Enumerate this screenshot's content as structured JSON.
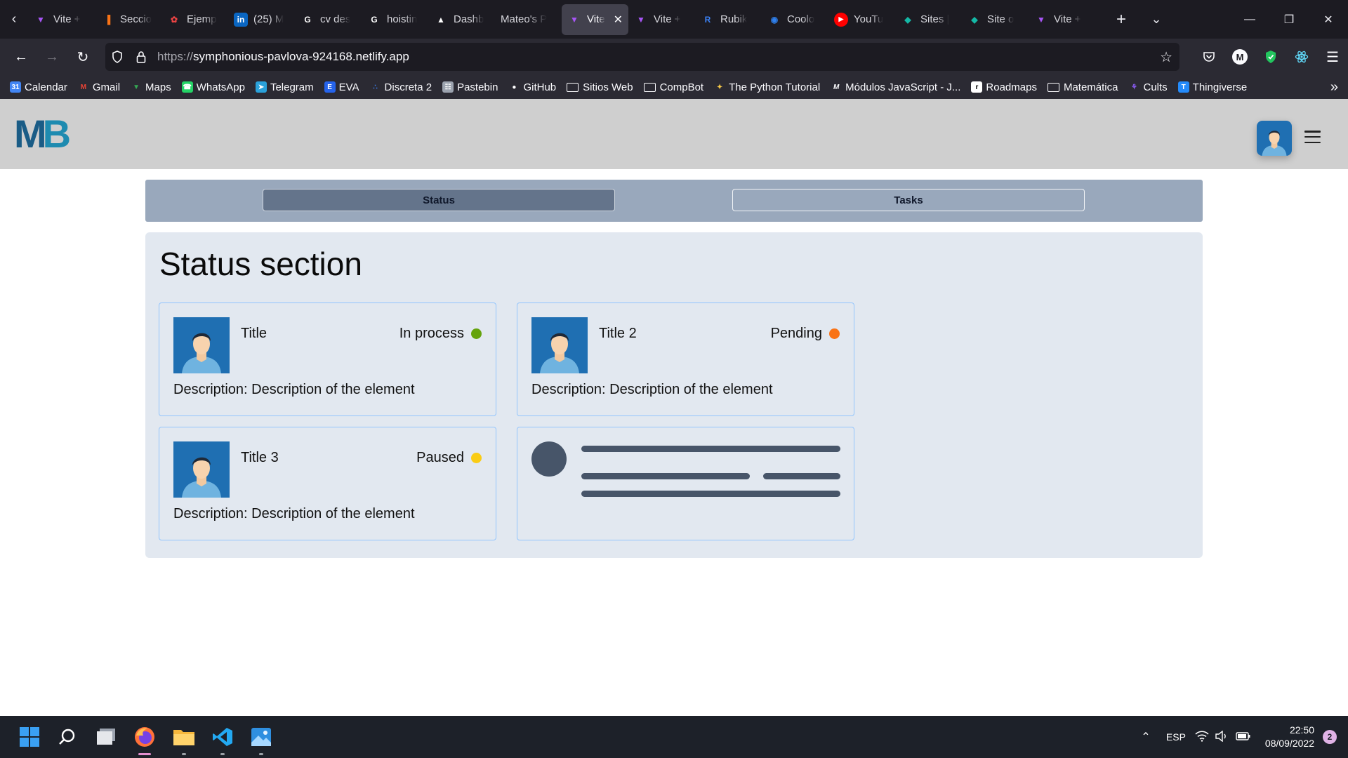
{
  "browser": {
    "tabs": [
      {
        "label": "Vite +",
        "favicon": "vite-icon",
        "color": "#a855f7"
      },
      {
        "label": "Seccio",
        "favicon": "bars-icon",
        "color": "#f97316"
      },
      {
        "label": "Ejemp",
        "favicon": "swirl-icon",
        "color": "#ef4444"
      },
      {
        "label": "(25) M",
        "favicon": "linkedin-icon",
        "color": "#0a66c2"
      },
      {
        "label": "cv des",
        "favicon": "google-icon",
        "color": "#ffffff"
      },
      {
        "label": "hoistin",
        "favicon": "google-icon",
        "color": "#ffffff"
      },
      {
        "label": "Dashb",
        "favicon": "triangle-icon",
        "color": "#ffffff"
      },
      {
        "label": "Mateo's P",
        "favicon": "",
        "color": "#1c1b22"
      },
      {
        "label": "Vite",
        "favicon": "vite-icon",
        "color": "#a855f7",
        "active": true
      },
      {
        "label": "Vite +",
        "favicon": "vite-icon",
        "color": "#a855f7"
      },
      {
        "label": "Rubik",
        "favicon": "rubik-icon",
        "color": "#3b82f6"
      },
      {
        "label": "Coolo",
        "favicon": "coolors-icon",
        "color": "#2f80ed"
      },
      {
        "label": "YouTu",
        "favicon": "youtube-icon",
        "color": "#ff0000"
      },
      {
        "label": "Sites |",
        "favicon": "diamond-icon",
        "color": "#14b8a6"
      },
      {
        "label": "Site o",
        "favicon": "diamond-icon",
        "color": "#14b8a6"
      },
      {
        "label": "Vite +",
        "favicon": "vite-icon",
        "color": "#a855f7"
      }
    ],
    "url_protocol": "https://",
    "url_host": "symphonious-pavlova-924168.netlify.app",
    "bookmarks": [
      {
        "label": "Calendar",
        "icon": "calendar-icon",
        "color": "#4285f4"
      },
      {
        "label": "Gmail",
        "icon": "gmail-icon",
        "color": "#ea4335"
      },
      {
        "label": "Maps",
        "icon": "maps-icon",
        "color": "#34a853"
      },
      {
        "label": "WhatsApp",
        "icon": "whatsapp-icon",
        "color": "#25d366"
      },
      {
        "label": "Telegram",
        "icon": "telegram-icon",
        "color": "#2aa1da"
      },
      {
        "label": "EVA",
        "icon": "eva-icon",
        "color": "#2563eb"
      },
      {
        "label": "Discreta 2",
        "icon": "discreta-icon",
        "color": "#3b82f6"
      },
      {
        "label": "Pastebin",
        "icon": "pastebin-icon",
        "color": "#9ca3af"
      },
      {
        "label": "GitHub",
        "icon": "github-icon",
        "color": "#ffffff"
      },
      {
        "label": "Sitios Web",
        "icon": "folder-icon",
        "color": ""
      },
      {
        "label": "CompBot",
        "icon": "folder-icon",
        "color": ""
      },
      {
        "label": "The Python Tutorial",
        "icon": "python-icon",
        "color": "#f7c948"
      },
      {
        "label": "Módulos JavaScript - J...",
        "icon": "m-icon",
        "color": "#1c1b22"
      },
      {
        "label": "Roadmaps",
        "icon": "roadmaps-icon",
        "color": "#ffffff"
      },
      {
        "label": "Matemática",
        "icon": "folder-icon",
        "color": ""
      },
      {
        "label": "Cults",
        "icon": "cults-icon",
        "color": "#8b5cf6"
      },
      {
        "label": "Thingiverse",
        "icon": "thingiverse-icon",
        "color": "#248bfb"
      }
    ]
  },
  "app": {
    "logo_m": "M",
    "logo_b": "B",
    "nav_tabs": [
      {
        "label": "Status",
        "active": true
      },
      {
        "label": "Tasks",
        "active": false
      }
    ],
    "section_title": "Status section",
    "cards": [
      {
        "title": "Title",
        "status": "In process",
        "status_color": "#65a30d",
        "description": "Description: Description of the element"
      },
      {
        "title": "Title 2",
        "status": "Pending",
        "status_color": "#f97316",
        "description": "Description: Description of the element"
      },
      {
        "title": "Title 3",
        "status": "Paused",
        "status_color": "#facc15",
        "description": "Description: Description of the element"
      }
    ]
  },
  "taskbar": {
    "language": "ESP",
    "time": "22:50",
    "date": "08/09/2022",
    "notifications": "2"
  }
}
